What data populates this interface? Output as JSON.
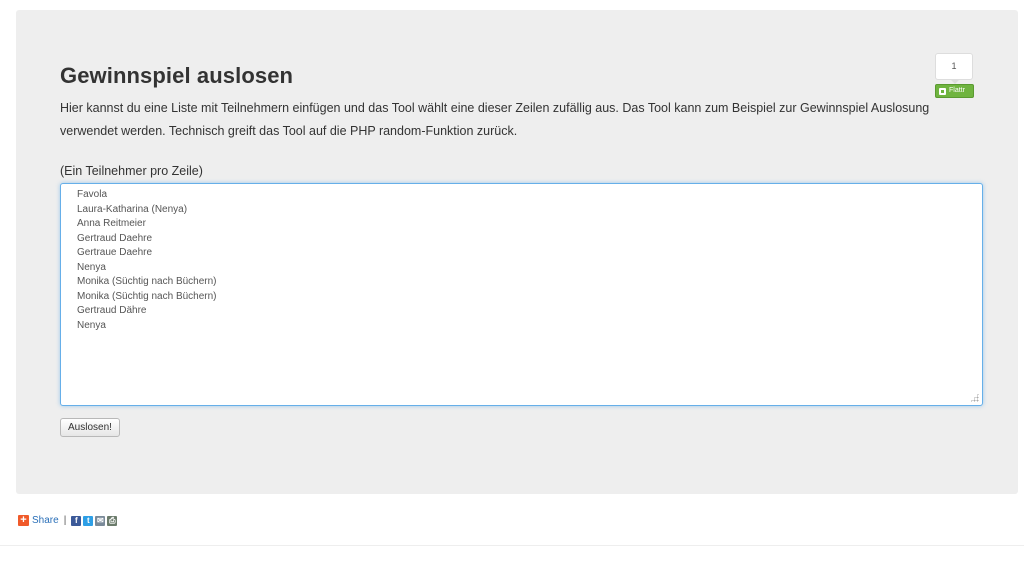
{
  "main": {
    "title": "Gewinnspiel auslosen",
    "description": "Hier kannst du eine Liste mit Teilnehmern einfügen und das Tool wählt eine dieser Zeilen zufällig aus. Das Tool kann zum Beispiel zur Gewinnspiel Auslosung verwendet werden. Technisch greift das Tool auf die PHP random-Funktion zurück.",
    "field_label": "(Ein Teilnehmer pro Zeile)",
    "participants": [
      "Favola",
      "Laura-Katharina (Nenya)",
      "Anna Reitmeier",
      "Gertraud Daehre",
      "Gertraue Daehre",
      "Nenya",
      "Monika (Süchtig nach Büchern)",
      "Monika (Süchtig nach Büchern)",
      "Gertraud Dähre",
      "Nenya"
    ],
    "submit_label": "Auslosen!"
  },
  "flattr": {
    "count": "1",
    "label": "Flattr",
    "color": "#6fb43f"
  },
  "share": {
    "label": "Share",
    "separator": "|",
    "icons": [
      "facebook-icon",
      "twitter-icon",
      "mail-icon",
      "print-icon"
    ]
  }
}
